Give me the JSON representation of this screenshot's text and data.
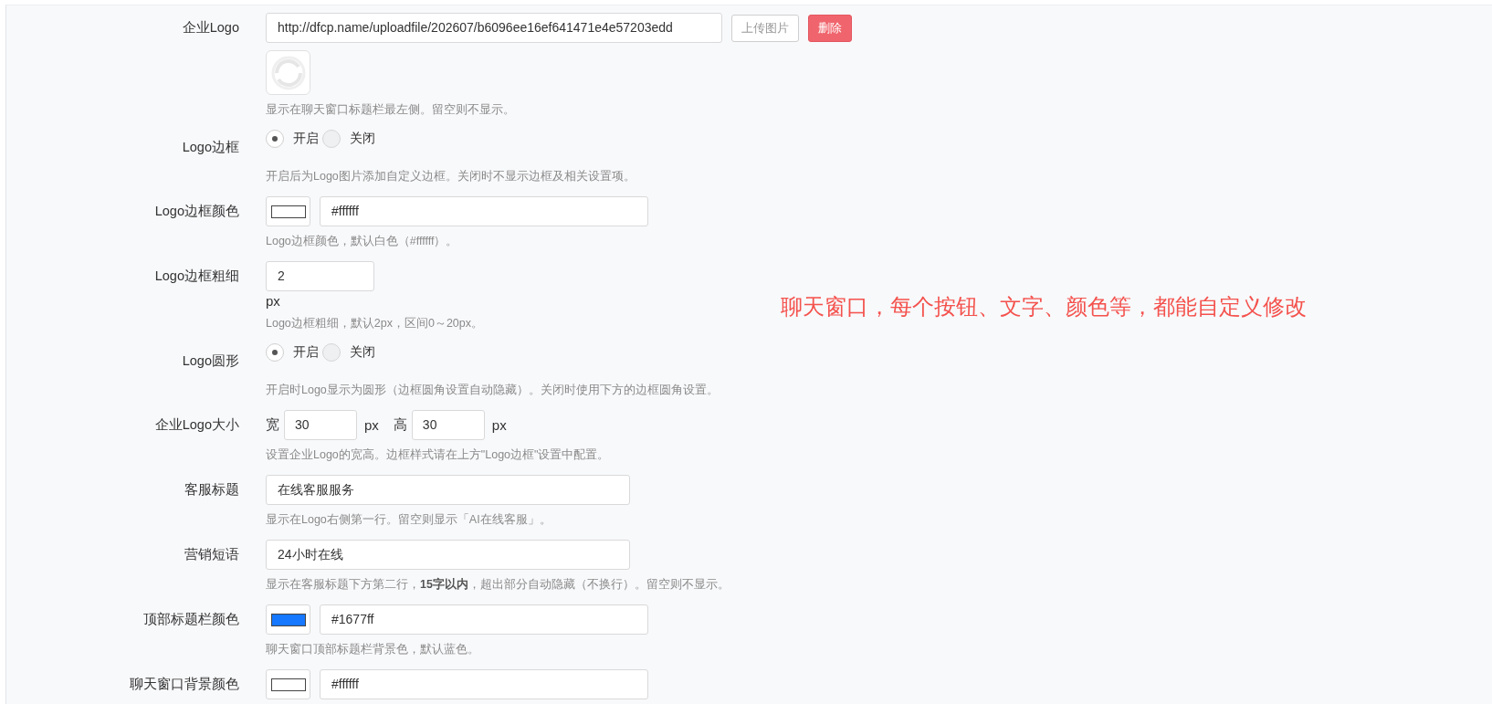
{
  "form": {
    "rows": [
      {
        "kind": "image_url",
        "label": "企业Logo",
        "value": "http://dfcp.name/uploadfile/202607/b6096ee16ef641471e4e57203edd",
        "buttons": [
          {
            "kind": "upload",
            "label": "上传图片"
          },
          {
            "kind": "delete",
            "label": "删除"
          }
        ],
        "help": "显示在聊天窗口标题栏最左侧。留空则不显示。"
      },
      {
        "kind": "radio",
        "label": "Logo边框",
        "options": [
          {
            "label": "开启",
            "selected": true
          },
          {
            "label": "关闭",
            "selected": false
          }
        ],
        "help": "开启后为Logo图片添加自定义边框。关闭时不显示边框及相关设置项。"
      },
      {
        "kind": "color",
        "label": "Logo边框颜色",
        "color": "#ffffff",
        "value": "#ffffff",
        "help": "Logo边框颜色，默认白色（#ffffff）。"
      },
      {
        "kind": "number",
        "label": "Logo边框粗细",
        "value": "2",
        "unit": "px",
        "help": "Logo边框粗细，默认2px，区间0～20px。"
      },
      {
        "kind": "radio",
        "label": "Logo圆形",
        "options": [
          {
            "label": "开启",
            "selected": true
          },
          {
            "label": "关闭",
            "selected": false
          }
        ],
        "help": "开启时Logo显示为圆形（边框圆角设置自动隐藏）。关闭时使用下方的边框圆角设置。"
      },
      {
        "kind": "size",
        "label": "企业Logo大小",
        "fields": [
          {
            "label": "宽",
            "value": "30",
            "unit": "px"
          },
          {
            "label": "高",
            "value": "30",
            "unit": "px"
          }
        ],
        "help": "设置企业Logo的宽高。边框样式请在上方\"Logo边框\"设置中配置。"
      },
      {
        "kind": "text",
        "label": "客服标题",
        "value": "在线客服服务",
        "help": "显示在Logo右侧第一行。留空则显示「AI在线客服」。"
      },
      {
        "kind": "text",
        "label": "营销短语",
        "value": "24小时在线",
        "help": "显示在客服标题下方第二行，**15字以内**，超出部分自动隐藏（不换行）。留空则不显示。"
      },
      {
        "kind": "color",
        "label": "顶部标题栏颜色",
        "color": "#1677ff",
        "value": "#1677ff",
        "help": "聊天窗口顶部标题栏背景色，默认蓝色。"
      },
      {
        "kind": "color",
        "label": "聊天窗口背景颜色",
        "color": "#ffffff",
        "value": "#ffffff"
      }
    ]
  },
  "annotation": "聊天窗口，每个按钮、文字、颜色等，都能自定义修改"
}
